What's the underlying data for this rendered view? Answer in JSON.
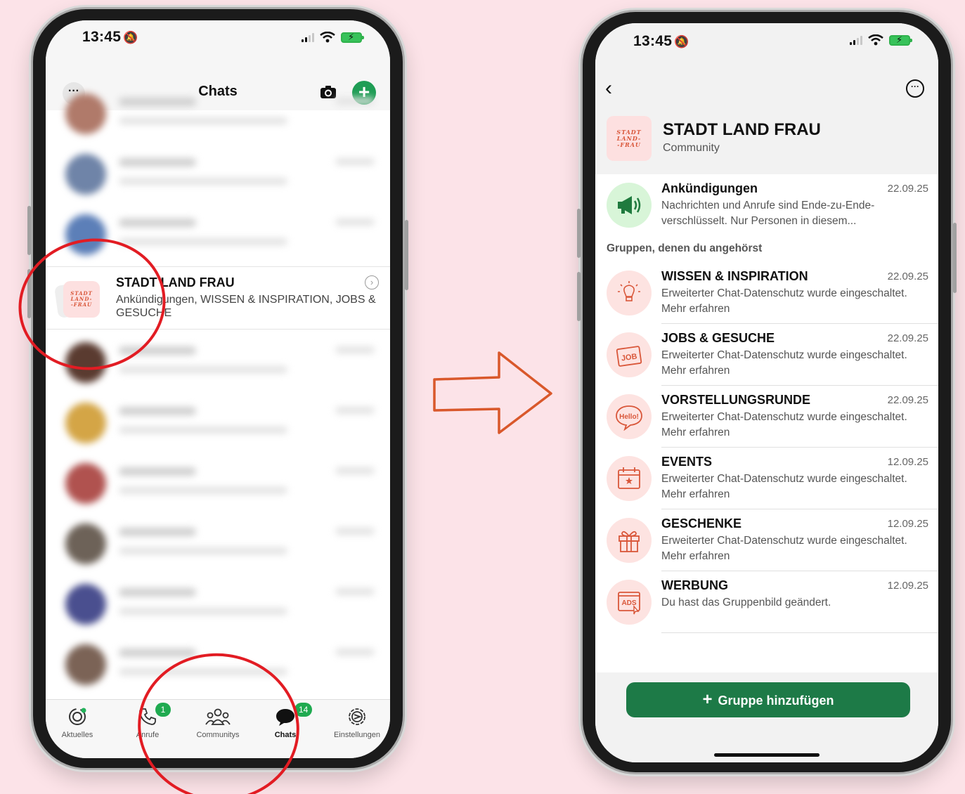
{
  "left_phone": {
    "status": {
      "time": "13:45"
    },
    "header": {
      "title": "Chats"
    },
    "community": {
      "logo_text": "STADT\nLAND-\n-FRAU",
      "title": "STADT LAND FRAU",
      "subtitle": "Ankündigungen, WISSEN & INSPIRATION, JOBS & GESUCHE"
    },
    "tabs": [
      {
        "label": "Aktuelles"
      },
      {
        "label": "Anrufe",
        "badge": "1"
      },
      {
        "label": "Communitys"
      },
      {
        "label": "Chats",
        "badge": "14"
      },
      {
        "label": "Einstellungen"
      }
    ]
  },
  "right_phone": {
    "status": {
      "time": "13:45"
    },
    "community": {
      "logo_text": "STADT\nLAND-\n-FRAU",
      "title": "STADT LAND FRAU",
      "subtitle": "Community"
    },
    "announcement": {
      "name": "Ankündigungen",
      "date": "22.09.25",
      "message": "Nachrichten und Anrufe sind Ende-zu-Ende-verschlüsselt. Nur Personen in diesem..."
    },
    "section_label": "Gruppen, denen du angehörst",
    "groups": [
      {
        "name": "WISSEN & INSPIRATION",
        "date": "22.09.25",
        "message": "Erweiterter Chat-Datenschutz wurde eingeschaltet. Mehr erfahren",
        "icon": "lightbulb-icon"
      },
      {
        "name": "JOBS & GESUCHE",
        "date": "22.09.25",
        "message": "Erweiterter Chat-Datenschutz wurde eingeschaltet. Mehr erfahren",
        "icon": "job-sign-icon",
        "icon_text": "JOB"
      },
      {
        "name": "VORSTELLUNGSRUNDE",
        "date": "22.09.25",
        "message": "Erweiterter Chat-Datenschutz wurde eingeschaltet. Mehr erfahren",
        "icon": "hello-bubble-icon",
        "icon_text": "Hello!"
      },
      {
        "name": "EVENTS",
        "date": "12.09.25",
        "message": "Erweiterter Chat-Datenschutz wurde eingeschaltet. Mehr erfahren",
        "icon": "calendar-icon"
      },
      {
        "name": "GESCHENKE",
        "date": "12.09.25",
        "message": "Erweiterter Chat-Datenschutz wurde eingeschaltet. Mehr erfahren",
        "icon": "gift-icon"
      },
      {
        "name": "WERBUNG",
        "date": "12.09.25",
        "message": "Du hast das Gruppenbild geändert.",
        "icon": "ads-icon",
        "icon_text": "ADS"
      }
    ],
    "add_button": "Gruppe hinzufügen"
  },
  "colors": {
    "background": "#fce3e8",
    "whatsapp_green": "#1d7a47",
    "annotation_red": "#e21c23",
    "arrow_orange": "#d9582b",
    "icon_orange": "#d9573a"
  }
}
